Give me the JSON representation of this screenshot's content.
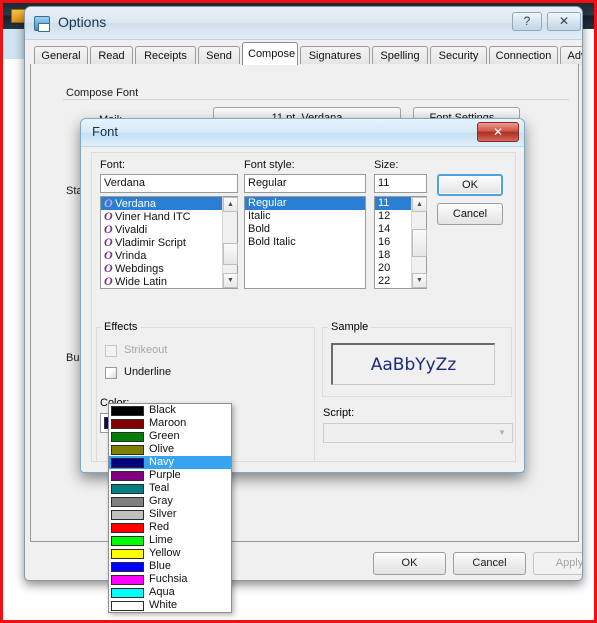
{
  "background_window": {
    "title_blurred": ""
  },
  "options_window": {
    "title": "Options",
    "icon": "save-disk-icon",
    "help_button": "?",
    "close_button": "✕",
    "tabs": [
      {
        "label": "General",
        "active": false
      },
      {
        "label": "Read",
        "active": false
      },
      {
        "label": "Receipts",
        "active": false
      },
      {
        "label": "Send",
        "active": false
      },
      {
        "label": "Compose",
        "active": true
      },
      {
        "label": "Signatures",
        "active": false
      },
      {
        "label": "Spelling",
        "active": false
      },
      {
        "label": "Security",
        "active": false
      },
      {
        "label": "Connection",
        "active": false
      },
      {
        "label": "Advanced",
        "active": false
      }
    ],
    "compose": {
      "group_label": "Compose Font",
      "mail_label": "Mail:",
      "mail_font_value": "11 pt. Verdana",
      "font_settings_label": "Font Settings...",
      "stationery_label": "Stationery",
      "business_label": "Business"
    },
    "buttons": {
      "ok": "OK",
      "cancel": "Cancel",
      "apply": "Apply"
    }
  },
  "font_dialog": {
    "title": "Font",
    "close_button": "✕",
    "font_label": "Font:",
    "font_value": "Verdana",
    "font_style_label": "Font style:",
    "font_style_value": "Regular",
    "size_label": "Size:",
    "size_value": "11",
    "font_list": [
      {
        "name": "Verdana",
        "selected": true
      },
      {
        "name": "Viner Hand ITC",
        "selected": false
      },
      {
        "name": "Vivaldi",
        "selected": false
      },
      {
        "name": "Vladimir Script",
        "selected": false
      },
      {
        "name": "Vrinda",
        "selected": false
      },
      {
        "name": "Webdings",
        "selected": false
      },
      {
        "name": "Wide Latin",
        "selected": false
      }
    ],
    "style_list": [
      {
        "name": "Regular",
        "selected": true
      },
      {
        "name": "Italic",
        "selected": false
      },
      {
        "name": "Bold",
        "selected": false
      },
      {
        "name": "Bold Italic",
        "selected": false
      }
    ],
    "size_list": [
      {
        "name": "11",
        "selected": true
      },
      {
        "name": "12",
        "selected": false
      },
      {
        "name": "14",
        "selected": false
      },
      {
        "name": "16",
        "selected": false
      },
      {
        "name": "18",
        "selected": false
      },
      {
        "name": "20",
        "selected": false
      },
      {
        "name": "22",
        "selected": false
      }
    ],
    "buttons": {
      "ok": "OK",
      "cancel": "Cancel"
    },
    "effects": {
      "group_label": "Effects",
      "strikeout_label": "Strikeout",
      "strikeout_checked": false,
      "strikeout_disabled": true,
      "underline_label": "Underline",
      "underline_checked": false
    },
    "color": {
      "label": "Color:",
      "selected": "Navy",
      "selected_hex": "#000080",
      "dropdown_open": true,
      "options": [
        {
          "label": "Black",
          "hex": "#000000",
          "selected": false
        },
        {
          "label": "Maroon",
          "hex": "#800000",
          "selected": false
        },
        {
          "label": "Green",
          "hex": "#008000",
          "selected": false
        },
        {
          "label": "Olive",
          "hex": "#808000",
          "selected": false
        },
        {
          "label": "Navy",
          "hex": "#000080",
          "selected": true
        },
        {
          "label": "Purple",
          "hex": "#800080",
          "selected": false
        },
        {
          "label": "Teal",
          "hex": "#008080",
          "selected": false
        },
        {
          "label": "Gray",
          "hex": "#808080",
          "selected": false
        },
        {
          "label": "Silver",
          "hex": "#c0c0c0",
          "selected": false
        },
        {
          "label": "Red",
          "hex": "#ff0000",
          "selected": false
        },
        {
          "label": "Lime",
          "hex": "#00ff00",
          "selected": false
        },
        {
          "label": "Yellow",
          "hex": "#ffff00",
          "selected": false
        },
        {
          "label": "Blue",
          "hex": "#0000ff",
          "selected": false
        },
        {
          "label": "Fuchsia",
          "hex": "#ff00ff",
          "selected": false
        },
        {
          "label": "Aqua",
          "hex": "#00ffff",
          "selected": false
        },
        {
          "label": "White",
          "hex": "#ffffff",
          "selected": false
        }
      ]
    },
    "sample": {
      "group_label": "Sample",
      "text": "AaBbYyZz",
      "text_color": "#1c2a7a"
    },
    "script": {
      "label": "Script:",
      "value": ""
    }
  },
  "accent_colors": {
    "selection_blue": "#2a7fd4",
    "dropdown_selection_blue": "#38a4f0",
    "capture_border_red": "#ee1111",
    "close_button_red": "#ab2f22"
  }
}
